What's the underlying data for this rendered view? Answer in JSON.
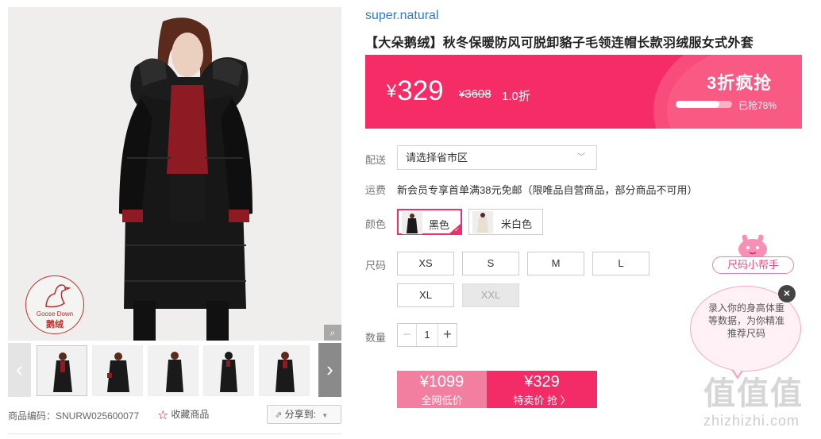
{
  "gallery": {
    "badge_en": "Goose Down",
    "badge_cn": "鹅绒",
    "zoom_icon": "magnifier-icon",
    "prev_icon": "chevron-left-icon",
    "next_icon": "chevron-right-icon",
    "thumb_count": 5
  },
  "meta": {
    "sku_label": "商品编码：SNURW025600077",
    "fav_icon": "star-outline-icon",
    "fav_label": "收藏商品",
    "share_label": "分享到:"
  },
  "product": {
    "brand": "super.natural",
    "title": "【大朵鹅绒】秋冬保暖防风可脱卸貉子毛领连帽长款羽绒服女式外套"
  },
  "price": {
    "currency": "¥",
    "current": "329",
    "original": "3608",
    "discount": "1.0折",
    "flash_title": "3折疯抢",
    "sold_ratio": 0.78,
    "sold_label": "已抢78%"
  },
  "shipping": {
    "label": "配送",
    "placeholder": "请选择省市区",
    "freight_label": "运费",
    "freight_text": "新会员专享首单满38元免邮（限唯品自营商品，部分商品不可用）"
  },
  "colors": {
    "label": "颜色",
    "options": [
      "黑色",
      "米白色"
    ],
    "selected": "黑色"
  },
  "sizes": {
    "label": "尺码",
    "options": [
      "XS",
      "S",
      "M",
      "L",
      "XL",
      "XXL"
    ],
    "disabled": [
      "XXL"
    ]
  },
  "quantity": {
    "label": "数量",
    "value": "1",
    "minus": "−",
    "plus": "+"
  },
  "buy": {
    "market_price": "¥1099",
    "market_label": "全网低价",
    "sale_price": "¥329",
    "sale_label": "特卖价 抢 〉"
  },
  "helper": {
    "tag": "尺码小帮手",
    "text": "录入你的身高体重等数据，为你精准推荐尺码",
    "close": "×"
  },
  "watermark": {
    "big": "值值值",
    "url": "zhizhizhi.com"
  },
  "colors_theme": {
    "accent": "#f52c65",
    "brand_link": "#2a7bd3"
  }
}
